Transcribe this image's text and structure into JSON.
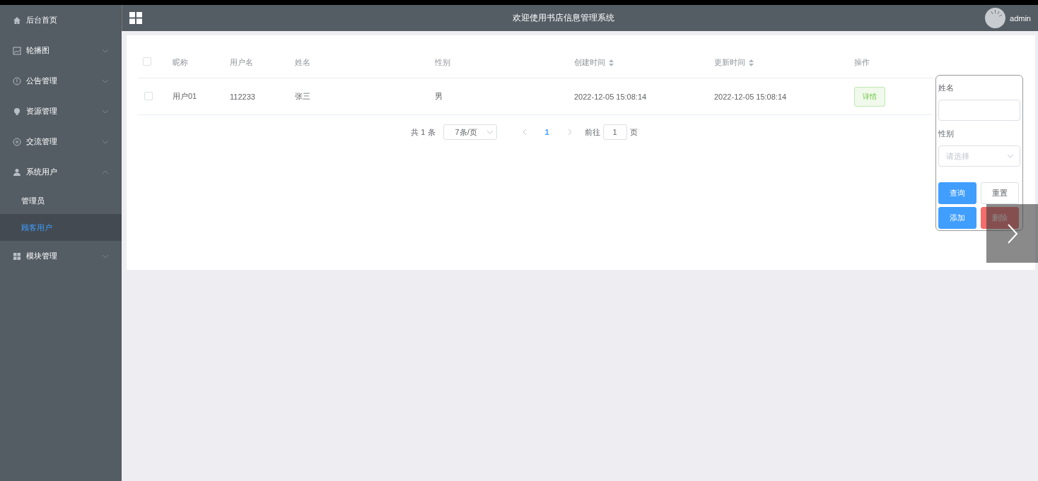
{
  "header": {
    "title": "欢迎使用书店信息管理系统",
    "user": "admin"
  },
  "sidebar": {
    "items": [
      {
        "label": "后台首页",
        "selected": false
      },
      {
        "label": "轮播图",
        "selected": false,
        "expanded": false
      },
      {
        "label": "公告管理",
        "selected": false,
        "expanded": false
      },
      {
        "label": "资源管理",
        "selected": false,
        "expanded": false
      },
      {
        "label": "交流管理",
        "selected": false,
        "expanded": false
      },
      {
        "label": "系统用户",
        "selected": false,
        "expanded": true,
        "children": [
          {
            "label": "管理员",
            "selected": false
          },
          {
            "label": "顾客用户",
            "selected": true
          }
        ]
      },
      {
        "label": "模块管理",
        "selected": false,
        "expanded": false
      }
    ]
  },
  "table": {
    "select_all": {
      "checked": false
    },
    "columns": [
      {
        "label": "昵称",
        "sortable": false
      },
      {
        "label": "用户名",
        "sortable": false
      },
      {
        "label": "姓名",
        "sortable": false
      },
      {
        "label": "性别",
        "sortable": false
      },
      {
        "label": "创建时间",
        "sortable": true
      },
      {
        "label": "更新时间",
        "sortable": true
      },
      {
        "label": "操作",
        "sortable": false
      }
    ],
    "rows": [
      {
        "checked": false,
        "cells": [
          "用户01",
          "112233",
          "张三",
          "男",
          "2022-12-05 15:08:14",
          "2022-12-05 15:08:14"
        ],
        "action": "详情"
      }
    ]
  },
  "pagination": {
    "total": "共 1 条",
    "page_size": "7条/页",
    "pages": [
      {
        "label": "1",
        "selected": true
      }
    ],
    "goto_label": "前往",
    "goto_value": "1",
    "page_unit": "页"
  },
  "filter_panel": {
    "fields": [
      {
        "kind": "text",
        "label": "姓名"
      },
      {
        "kind": "select",
        "label": "性别",
        "placeholder": "请选择"
      }
    ],
    "buttons": [
      {
        "label": "查询",
        "kind": "primary"
      },
      {
        "label": "重置",
        "kind": "default"
      },
      {
        "label": "添加",
        "kind": "primary"
      },
      {
        "label": "删除",
        "kind": "danger"
      }
    ]
  }
}
